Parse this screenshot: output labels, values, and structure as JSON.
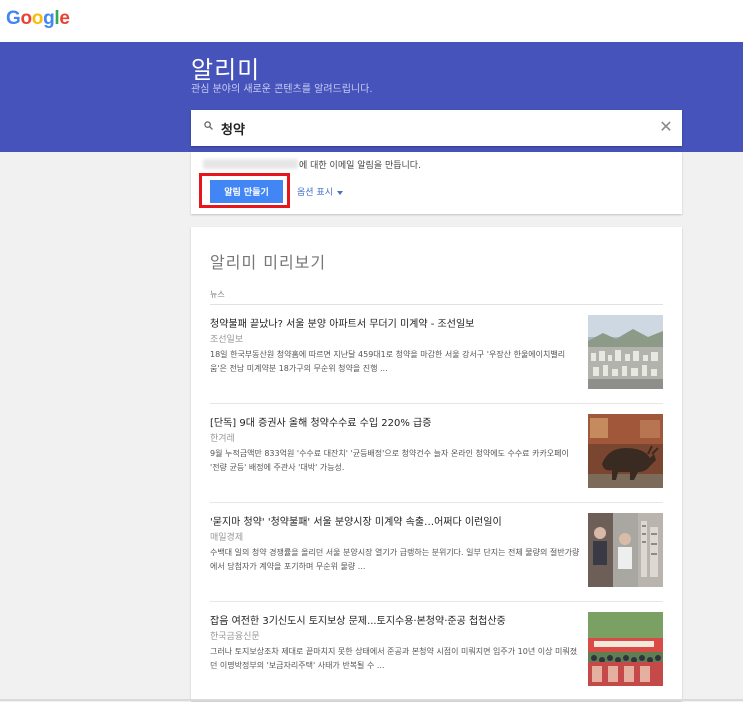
{
  "brand": {
    "logo_letters": [
      {
        "ch": "G",
        "color": "#4285f4"
      },
      {
        "ch": "o",
        "color": "#ea4335"
      },
      {
        "ch": "o",
        "color": "#fbbc05"
      },
      {
        "ch": "g",
        "color": "#4285f4"
      },
      {
        "ch": "l",
        "color": "#34a853"
      },
      {
        "ch": "e",
        "color": "#ea4335"
      }
    ]
  },
  "header": {
    "title": "알리미",
    "subtitle": "관심 분야의 새로운 콘텐츠를 알려드립니다.",
    "accent_color": "#4553bb"
  },
  "search": {
    "value": "청약",
    "icon": "search-icon",
    "clear_icon": "close-icon",
    "clear_glyph": "✕"
  },
  "create": {
    "email_suffix": "에 대한 이메일 알림을 만듭니다.",
    "button_label": "알림 만들기",
    "options_label": "옵션 표시",
    "button_color": "#4285f4",
    "highlight_color": "#e6161d"
  },
  "preview": {
    "title": "알리미 미리보기",
    "section": "뉴스",
    "items": [
      {
        "title": "청약불패 끝났나? 서울 분양 아파트서 무더기 미계약 - 조선일보",
        "source": "조선일보",
        "snippet": "18일 한국부동산원 청약홈에 따르면 지난달 459대1로 청약을 마감한 서울 강서구 '우장산 한울에이치밸리움'은 전남 미계약분 18가구의 무순위 청약을 진행 ..."
      },
      {
        "title": "[단독] 9대 증권사 올해 청약수수료 수입 220% 급증",
        "source": "한겨레",
        "snippet": "9월 누적금액만 833억원 '수수료 대잔치' '균등배정'으로 청약건수 늘자 온라인 청약에도 수수료 카카오페이 '전량 균등' 배정에 주관사 '대박' 가능성."
      },
      {
        "title": "'묻지마 청약' '청약불패' 서울 분양시장 미계약 속출…어쩌다 이런일이",
        "source": "매일경제",
        "snippet": "수백대 일의 청약 경쟁률을 올리던 서울 분양시장 열기가 급랭하는 분위기다. 일부 단지는 전체 물량의 절반가량에서 당첨자가 계약을 포기하며 무순위 물량 ..."
      },
      {
        "title": "잡음 여전한 3기신도시 토지보상 문제...토지수용·본청약·준공 첩첩산중",
        "source": "한국금융신문",
        "snippet": "그러나 토지보상조차 제대로 끝마치지 못한 상태에서 준공과 본청약 시점이 미뤄지면 입주가 10년 이상 미뤄졌던 이명박정부의 '보금자리주택' 사태가 반복될 수 ..."
      }
    ]
  }
}
